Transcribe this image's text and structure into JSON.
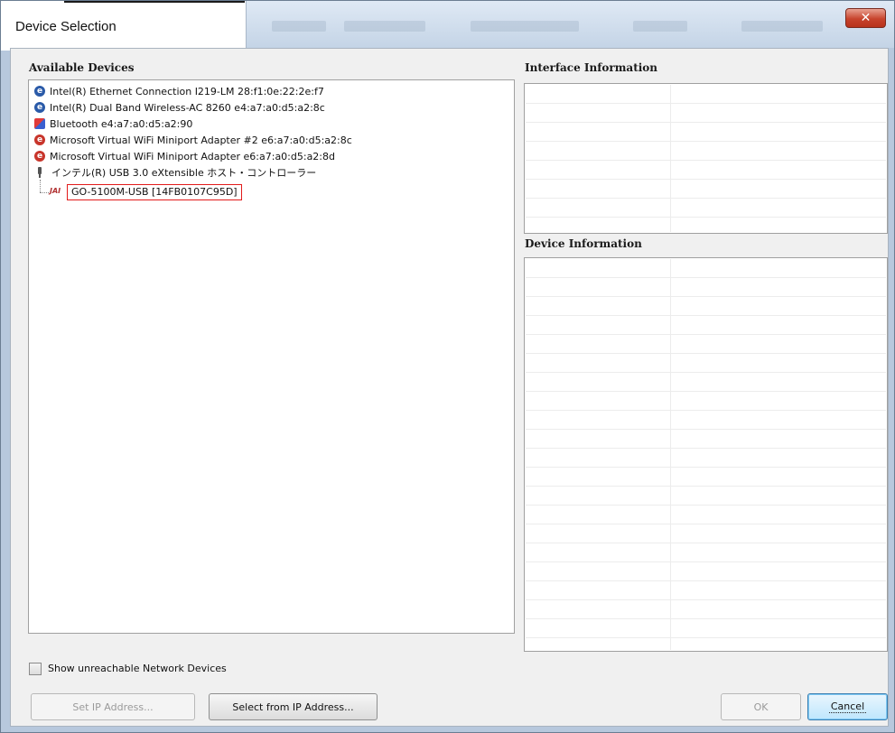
{
  "window": {
    "title": "Device Selection",
    "close_glyph": "✕"
  },
  "available_devices": {
    "label": "Available Devices",
    "items": [
      {
        "icon": "network-adapter-icon",
        "text": "Intel(R) Ethernet Connection I219-LM 28:f1:0e:22:2e:f7"
      },
      {
        "icon": "network-adapter-icon",
        "text": "Intel(R) Dual Band Wireless-AC 8260 e4:a7:a0:d5:a2:8c"
      },
      {
        "icon": "bluetooth-icon",
        "text": "Bluetooth  e4:a7:a0:d5:a2:90"
      },
      {
        "icon": "virtual-adapter-icon",
        "text": "Microsoft Virtual WiFi Miniport Adapter #2 e6:a7:a0:d5:a2:8c"
      },
      {
        "icon": "virtual-adapter-icon",
        "text": "Microsoft Virtual WiFi Miniport Adapter e6:a7:a0:d5:a2:8d"
      },
      {
        "icon": "usb-icon",
        "text": "インテル(R) USB 3.0 eXtensible ホスト・コントローラー"
      }
    ],
    "child_item": {
      "icon_text": "JAI",
      "text": "GO-5100M-USB [14FB0107C95D]"
    }
  },
  "interface_info": {
    "label": "Interface Information"
  },
  "device_info": {
    "label": "Device Information"
  },
  "show_unreachable": {
    "label": "Show unreachable Network Devices",
    "checked": false
  },
  "buttons": {
    "set_ip": "Set IP Address...",
    "select_from_ip": "Select from IP Address...",
    "ok": "OK",
    "cancel": "Cancel"
  },
  "colors": {
    "selection_outline": "#e21b1b",
    "close_button": "#c7432c",
    "default_button": "#bee6fd"
  }
}
